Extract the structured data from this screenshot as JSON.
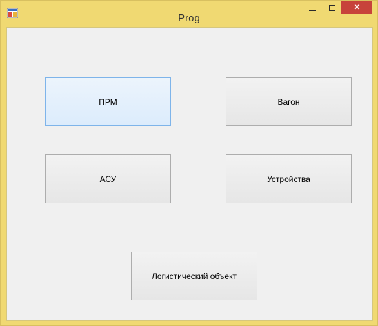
{
  "window": {
    "title": "Prog",
    "app_icon": "winforms-app-icon",
    "controls": {
      "minimize_icon": "minimize-icon",
      "maximize_icon": "maximize-icon",
      "close_label": "×"
    },
    "colors": {
      "titlebar": "#f0d972",
      "close_button": "#c7433b",
      "client_background": "#f0f0f0"
    }
  },
  "buttons": {
    "prm": "ПРМ",
    "wagon": "Вагон",
    "asu": "АСУ",
    "devices": "Устройства",
    "logistic_object": "Логистический объект"
  }
}
